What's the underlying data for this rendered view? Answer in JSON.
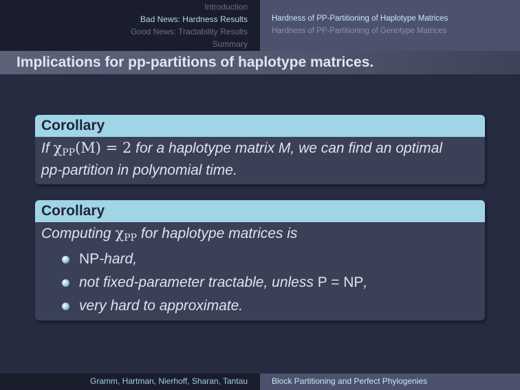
{
  "header": {
    "sections": [
      {
        "label": "Introduction",
        "active": false
      },
      {
        "label": "Bad News: Hardness Results",
        "active": true
      },
      {
        "label": "Good News: Tractability Results",
        "active": false
      },
      {
        "label": "Summary",
        "active": false
      }
    ],
    "subsections": [
      {
        "label": "Hardness of PP-Partitioning of Haplotype Matrices",
        "active": true
      },
      {
        "label": "Hardness of PP-Partitioning of Genotype Matrices",
        "active": false
      }
    ]
  },
  "frame_title": "Implications for pp-partitions of haplotype matrices.",
  "blocks": [
    {
      "title": "Corollary",
      "text_if": "If",
      "chi": "χ",
      "pp": "PP",
      "m_arg": "(M) = 2",
      "text_mid": "for a haplotype matrix M, we can find an optimal",
      "text_end": "pp-partition in polynomial time."
    },
    {
      "title": "Corollary",
      "text_start": "Computing",
      "chi": "χ",
      "pp": "PP",
      "text_end": "for haplotype matrices is",
      "items": [
        {
          "np": "NP",
          "rest": "-hard,"
        },
        {
          "text": "not fixed-parameter tractable, unless",
          "math": "P = NP",
          "tail": ","
        },
        {
          "text": "very hard to approximate."
        }
      ]
    }
  ],
  "footer": {
    "authors": "Gramm, Hartman, Nierhoff, Sharan, Tantau",
    "talk_title": "Block Partitioning and Perfect Phylogenies"
  }
}
